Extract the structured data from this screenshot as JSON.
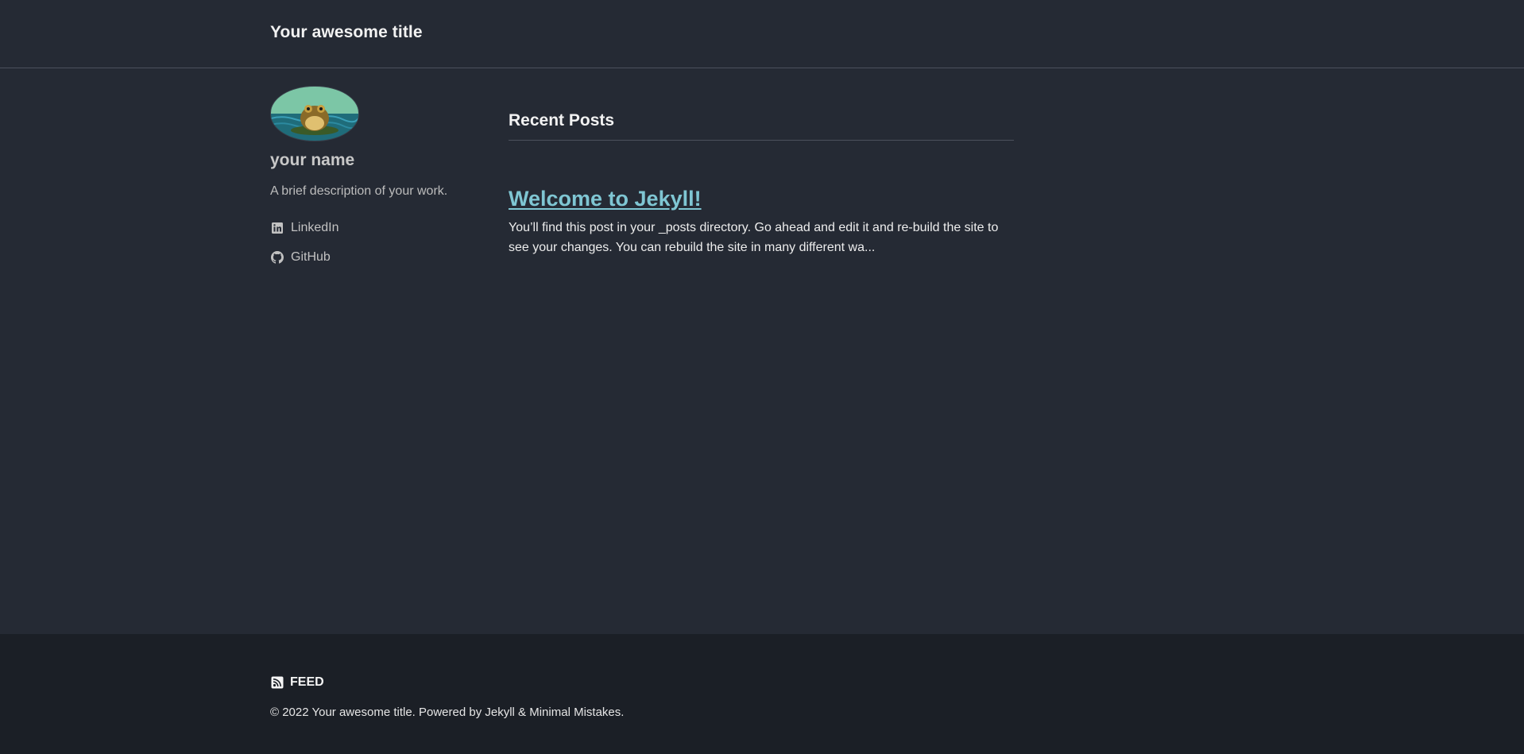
{
  "header": {
    "site_title": "Your awesome title"
  },
  "sidebar": {
    "avatar_icon": "toad-avatar",
    "author_name": "your name",
    "author_bio": "A brief description of your work.",
    "links": [
      {
        "label": "LinkedIn",
        "icon": "linkedin-icon"
      },
      {
        "label": "GitHub",
        "icon": "github-icon"
      }
    ]
  },
  "main": {
    "section_title": "Recent Posts",
    "posts": [
      {
        "title": "Welcome to Jekyll!",
        "excerpt": "You’ll find this post in your _posts directory. Go ahead and edit it and re-build the site to see your changes. You can rebuild the site in many different wa..."
      }
    ]
  },
  "footer": {
    "feed_label": "FEED",
    "copyright": "© 2022 Your awesome title. Powered by Jekyll & Minimal Mistakes."
  },
  "colors": {
    "background": "#252a34",
    "footer_background": "#1b1f26",
    "link": "#7fc6d3"
  }
}
